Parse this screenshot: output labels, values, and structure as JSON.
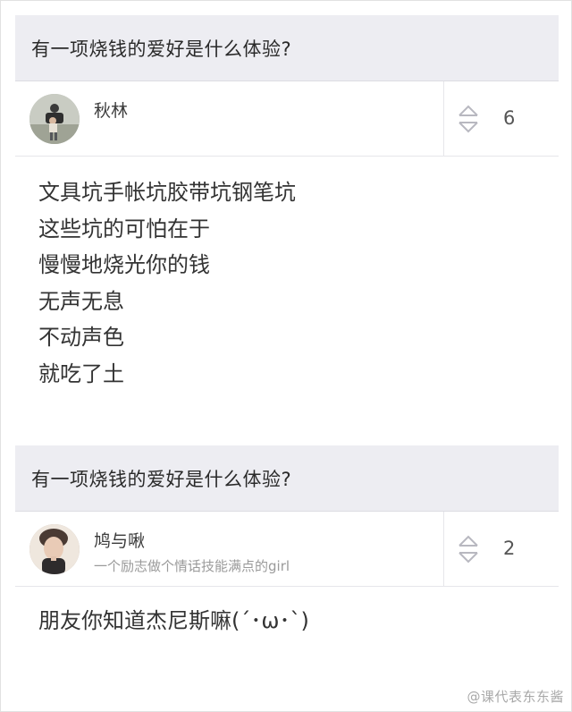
{
  "answers": [
    {
      "question": "有一项烧钱的爱好是什么体验?",
      "author": {
        "name": "秋林",
        "bio": "",
        "avatar_icon": "user-avatar-icon"
      },
      "votes": "6",
      "lines": [
        "文具坑手帐坑胶带坑钢笔坑",
        "这些坑的可怕在于",
        "慢慢地烧光你的钱",
        "无声无息",
        "不动声色",
        "就吃了土"
      ]
    },
    {
      "question": "有一项烧钱的爱好是什么体验?",
      "author": {
        "name": "鸠与啾",
        "bio": "一个励志做个情话技能满点的girl",
        "avatar_icon": "user-avatar-icon"
      },
      "votes": "2",
      "lines": [
        "朋友你知道杰尼斯嘛(´･ω･`)"
      ]
    }
  ],
  "watermark": "@课代表东东酱",
  "colors": {
    "header_bg": "#ededf2",
    "divider": "#e6e6ea",
    "text_main": "#333333",
    "text_muted": "#9a9a9a",
    "icon_gray": "#b8b8c0"
  }
}
